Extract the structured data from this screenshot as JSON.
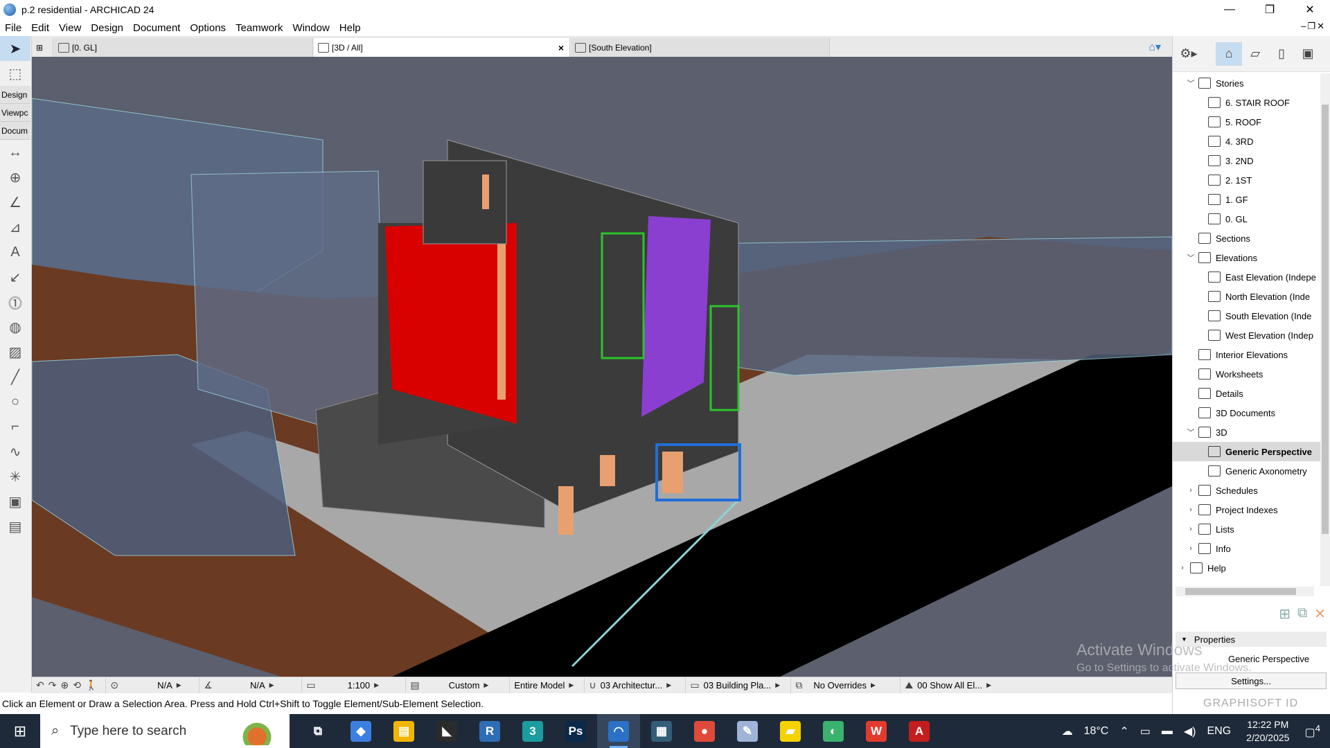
{
  "window": {
    "title": "p.2 residential - ARCHICAD 24",
    "minimize": "—",
    "restore": "❐",
    "close": "✕"
  },
  "menu": [
    "File",
    "Edit",
    "View",
    "Design",
    "Document",
    "Options",
    "Teamwork",
    "Window",
    "Help"
  ],
  "toolbox": {
    "tabs": [
      "Design",
      "Viewpc",
      "Docum"
    ],
    "icons": [
      "arrow-select-icon",
      "marquee-icon",
      "dimension-icon",
      "radial-dimension-icon",
      "angle-dimension-icon",
      "level-dimension-icon",
      "text-icon",
      "label-icon",
      "marker-icon",
      "fill-icon",
      "hatch-icon",
      "line-icon",
      "circle-icon",
      "polyline-icon",
      "spline-icon",
      "hotspot-icon",
      "figure-icon",
      "drawing-icon"
    ]
  },
  "tabs": [
    {
      "label": "[0. GL]",
      "icon": "floor-plan-icon"
    },
    {
      "label": "[3D / All]",
      "icon": "3d-window-icon",
      "close": "×"
    },
    {
      "label": "[South Elevation]",
      "icon": "elevation-icon"
    }
  ],
  "quickbar": {
    "undo": "↶",
    "redo": "↷",
    "zoom": "⊕",
    "orbit": "⟲",
    "walk": "🚶",
    "zoom_value": "N/A",
    "angle_value": "N/A",
    "scale": "1:100",
    "structure": "Custom",
    "model": "Entire Model",
    "pen_set": "03 Architectur...",
    "model_view": "03 Building Pla...",
    "overrides": "No Overrides",
    "layers": "00 Show All El..."
  },
  "hint": "Click an Element or Draw a Selection Area. Press and Hold Ctrl+Shift to Toggle Element/Sub-Element Selection.",
  "navigator": {
    "tree": [
      {
        "label": "Stories",
        "level": 1,
        "expander": "﹀",
        "icon": "stories-icon"
      },
      {
        "label": "6. STAIR ROOF",
        "level": 2,
        "icon": "story-icon"
      },
      {
        "label": "5. ROOF",
        "level": 2,
        "icon": "story-icon"
      },
      {
        "label": "4. 3RD",
        "level": 2,
        "icon": "story-icon"
      },
      {
        "label": "3. 2ND",
        "level": 2,
        "icon": "story-icon"
      },
      {
        "label": "2. 1ST",
        "level": 2,
        "icon": "story-icon"
      },
      {
        "label": "1. GF",
        "level": 2,
        "icon": "story-icon"
      },
      {
        "label": "0. GL",
        "level": 2,
        "icon": "story-icon"
      },
      {
        "label": "Sections",
        "level": 1,
        "icon": "section-icon"
      },
      {
        "label": "Elevations",
        "level": 1,
        "expander": "﹀",
        "icon": "elevation-icon"
      },
      {
        "label": "East Elevation (Indepe",
        "level": 2,
        "icon": "elevation-icon"
      },
      {
        "label": "North Elevation (Inde",
        "level": 2,
        "icon": "elevation-icon"
      },
      {
        "label": "South Elevation (Inde",
        "level": 2,
        "icon": "elevation-icon"
      },
      {
        "label": "West Elevation (Indep",
        "level": 2,
        "icon": "elevation-icon"
      },
      {
        "label": "Interior Elevations",
        "level": 1,
        "icon": "interior-elevation-icon"
      },
      {
        "label": "Worksheets",
        "level": 1,
        "icon": "worksheet-icon"
      },
      {
        "label": "Details",
        "level": 1,
        "icon": "detail-icon"
      },
      {
        "label": "3D Documents",
        "level": 1,
        "icon": "3d-document-icon"
      },
      {
        "label": "3D",
        "level": 1,
        "expander": "﹀",
        "icon": "3d-icon"
      },
      {
        "label": "Generic Perspective",
        "level": 2,
        "icon": "perspective-icon",
        "selected": true
      },
      {
        "label": "Generic Axonometry",
        "level": 2,
        "icon": "axonometry-icon"
      },
      {
        "label": "Schedules",
        "level": 1,
        "expander": "›",
        "icon": "schedule-icon"
      },
      {
        "label": "Project Indexes",
        "level": 1,
        "expander": "›",
        "icon": "index-icon"
      },
      {
        "label": "Lists",
        "level": 1,
        "expander": "›",
        "icon": "list-icon"
      },
      {
        "label": "Info",
        "level": 1,
        "expander": "›",
        "icon": "info-icon"
      },
      {
        "label": "Help",
        "level": 0,
        "expander": "›",
        "icon": "help-icon"
      }
    ],
    "properties_label": "Properties",
    "properties_value": "Generic Perspective",
    "settings_label": "Settings...",
    "brand": "GRAPHISOFT ID"
  },
  "activation": {
    "line1": "Activate Windows",
    "line2": "Go to Settings to activate Windows."
  },
  "taskbar": {
    "search_placeholder": "Type here to search",
    "apps": [
      {
        "name": "task-view",
        "color": "#1e2a3a",
        "glyph": "⧉"
      },
      {
        "name": "copilot",
        "color": "#3d7fe0",
        "glyph": "◆"
      },
      {
        "name": "file-explorer",
        "color": "#f2b600",
        "glyph": "▤"
      },
      {
        "name": "sketchup",
        "color": "#2b2b2b",
        "glyph": "◣"
      },
      {
        "name": "revit",
        "color": "#2f6db5",
        "glyph": "R"
      },
      {
        "name": "3ds-max",
        "color": "#1b9c9e",
        "glyph": "3"
      },
      {
        "name": "photoshop",
        "color": "#0b2a4a",
        "glyph": "Ps"
      },
      {
        "name": "archicad",
        "color": "#2a71c7",
        "glyph": "◠",
        "active": true
      },
      {
        "name": "autocad-viewer",
        "color": "#335d78",
        "glyph": "▦"
      },
      {
        "name": "chrome",
        "color": "#e04a3a",
        "glyph": "●"
      },
      {
        "name": "paint",
        "color": "#9fb4d8",
        "glyph": "✎"
      },
      {
        "name": "sticky-notes",
        "color": "#f6d200",
        "glyph": "▰"
      },
      {
        "name": "edge",
        "color": "#3bb26e",
        "glyph": "◐"
      },
      {
        "name": "wps-office",
        "color": "#e23b2e",
        "glyph": "W"
      },
      {
        "name": "acrobat",
        "color": "#c31d1d",
        "glyph": "A"
      }
    ],
    "weather": "18°C",
    "language": "ENG",
    "time": "12:22 PM",
    "date": "2/20/2025",
    "notifications": "4"
  },
  "colors": {
    "accent": "#c6dcf0",
    "red_panel": "#d90000",
    "purple_panel": "#8a3fd0",
    "green_frame": "#2bc42b",
    "blue_frame": "#1f6fd9",
    "road": "#000000",
    "ground": "#6b3a22",
    "sidewalk": "#a9a9a9"
  }
}
